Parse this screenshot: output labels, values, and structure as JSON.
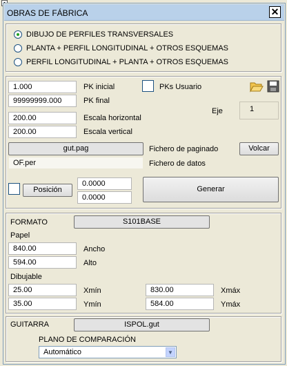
{
  "window": {
    "title": "OBRAS DE FÁBRICA",
    "close_symbol": "✕"
  },
  "radios": [
    {
      "label": "DIBUJO DE PERFILES TRANSVERSALES",
      "selected": true
    },
    {
      "label": "PLANTA + PERFIL LONGITUDINAL + OTROS ESQUEMAS",
      "selected": false
    },
    {
      "label": "PERFIL LONGITUDINAL + PLANTA + OTROS ESQUEMAS",
      "selected": false
    }
  ],
  "params": {
    "pk_inicial_value": "1.000",
    "pk_inicial_label": "PK inicial",
    "pk_final_value": "99999999.000",
    "pk_final_label": "PK final",
    "escala_h_value": "200.00",
    "escala_h_label": "Escala horizontal",
    "escala_v_value": "200.00",
    "escala_v_label": "Escala vertical",
    "pks_usuario_label": "PKs Usuario",
    "eje_label": "Eje",
    "eje_value": "1",
    "paginado_file": "gut.pag",
    "paginado_label": "Fichero de paginado",
    "volcar_label": "Volcar",
    "datos_file": "OF.per",
    "datos_label": "Fichero de datos",
    "posicion_label": "Posición",
    "pos_x": "0.0000",
    "pos_y": "0.0000",
    "generar_label": "Generar"
  },
  "formato": {
    "label": "FORMATO",
    "value": "S101BASE",
    "papel_label": "Papel",
    "ancho_value": "840.00",
    "ancho_label": "Ancho",
    "alto_value": "594.00",
    "alto_label": "Alto",
    "dibujable_label": "Dibujable",
    "xmin_value": "25.00",
    "xmin_label": "Xmín",
    "xmax_value": "830.00",
    "xmax_label": "Xmáx",
    "ymin_value": "35.00",
    "ymin_label": "Ymín",
    "ymax_value": "584.00",
    "ymax_label": "Ymáx"
  },
  "guitarra": {
    "label": "GUITARRA",
    "value": "ISPOL.gut",
    "plano_label": "PLANO DE COMPARACIÓN",
    "plano_value": "Automático"
  },
  "icons": {
    "open": "folder-open-icon",
    "save": "floppy-disk-icon",
    "pin": "pin-icon",
    "dropdown": "chevron-down-icon"
  }
}
